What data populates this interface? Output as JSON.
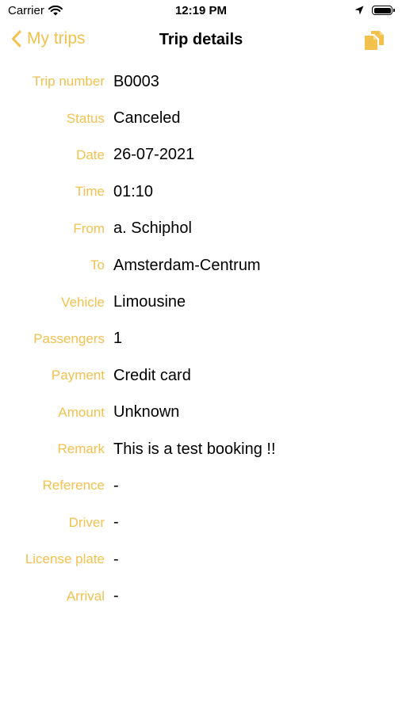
{
  "status_bar": {
    "carrier": "Carrier",
    "time": "12:19 PM"
  },
  "nav": {
    "back_label": "My trips",
    "title": "Trip details",
    "copy_icon": "copy-icon"
  },
  "colors": {
    "accent": "#F2C14E",
    "text": "#000000",
    "background": "#FFFFFF"
  },
  "details": [
    {
      "label": "Trip number",
      "value": "B0003"
    },
    {
      "label": "Status",
      "value": "Canceled"
    },
    {
      "label": "Date",
      "value": "26-07-2021"
    },
    {
      "label": "Time",
      "value": "01:10"
    },
    {
      "label": "From",
      "value": "a. Schiphol"
    },
    {
      "label": "To",
      "value": "Amsterdam-Centrum"
    },
    {
      "label": "Vehicle",
      "value": "Limousine"
    },
    {
      "label": "Passengers",
      "value": "1"
    },
    {
      "label": "Payment",
      "value": "Credit card"
    },
    {
      "label": "Amount",
      "value": "Unknown"
    },
    {
      "label": "Remark",
      "value": "This is a test booking !!"
    },
    {
      "label": "Reference",
      "value": "-"
    },
    {
      "label": "Driver",
      "value": "-"
    },
    {
      "label": "License plate",
      "value": "-"
    },
    {
      "label": "Arrival",
      "value": "-"
    }
  ]
}
